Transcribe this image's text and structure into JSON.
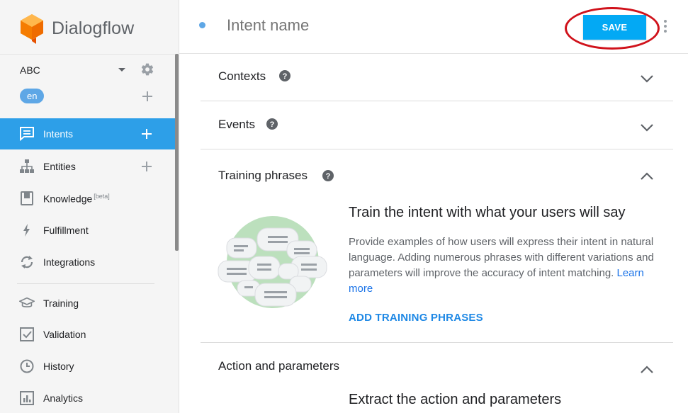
{
  "sidebar": {
    "logo_text": "Dialogflow",
    "agent_name": "ABC",
    "language": "en",
    "nav": [
      {
        "label": "Intents",
        "icon": "chat-bubble-icon",
        "active": true,
        "beta": ""
      },
      {
        "label": "Entities",
        "icon": "sitemap-icon",
        "active": false,
        "beta": ""
      },
      {
        "label": "Knowledge",
        "icon": "book-icon",
        "active": false,
        "beta": "[beta]"
      },
      {
        "label": "Fulfillment",
        "icon": "lightning-icon",
        "active": false,
        "beta": ""
      },
      {
        "label": "Integrations",
        "icon": "sync-icon",
        "active": false,
        "beta": ""
      },
      {
        "label": "Training",
        "icon": "graduation-cap-icon",
        "active": false,
        "beta": ""
      },
      {
        "label": "Validation",
        "icon": "checkbox-icon",
        "active": false,
        "beta": ""
      },
      {
        "label": "History",
        "icon": "clock-icon",
        "active": false,
        "beta": ""
      },
      {
        "label": "Analytics",
        "icon": "bar-chart-icon",
        "active": false,
        "beta": ""
      }
    ]
  },
  "header": {
    "intent_placeholder": "Intent name",
    "save_label": "SAVE"
  },
  "sections": {
    "contexts": "Contexts",
    "events": "Events",
    "training": "Training phrases",
    "action": "Action and parameters"
  },
  "training": {
    "heading": "Train the intent with what your users will say",
    "description": "Provide examples of how users will express their intent in natural language. Adding numerous phrases with different variations and parameters will improve the accuracy of intent matching.",
    "learn_more": "Learn more",
    "add_button": "ADD TRAINING PHRASES"
  },
  "action": {
    "heading": "Extract the action and parameters"
  },
  "colors": {
    "accent": "#03a9f4",
    "active_nav": "#2d9fe8",
    "highlight": "#d0121b"
  }
}
